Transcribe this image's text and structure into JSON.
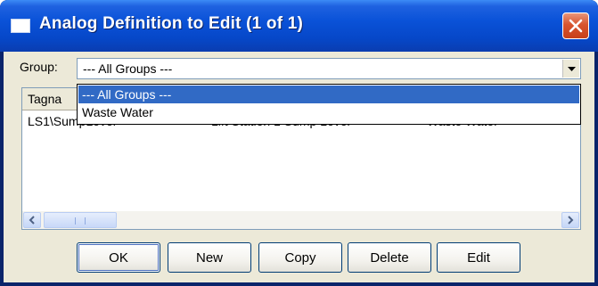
{
  "window": {
    "title": "Analog Definition to Edit (1 of 1)"
  },
  "group": {
    "label": "Group:",
    "selected_value": "--- All Groups ---",
    "options": [
      "--- All Groups ---",
      "Waste Water"
    ],
    "highlighted_index": 0
  },
  "list": {
    "columns": [
      "Tagna"
    ],
    "rows": [
      {
        "tagname": "LS1\\SumpLevel",
        "description": "Lift Station 1 Sump Level",
        "group": "Waste Water"
      }
    ]
  },
  "buttons": {
    "ok": "OK",
    "new": "New",
    "copy": "Copy",
    "delete": "Delete",
    "edit": "Edit"
  },
  "colors": {
    "titlebar": "#0a52d8",
    "dialog_bg": "#ece9d8",
    "selection": "#316ac5",
    "close_button": "#d8542e"
  }
}
